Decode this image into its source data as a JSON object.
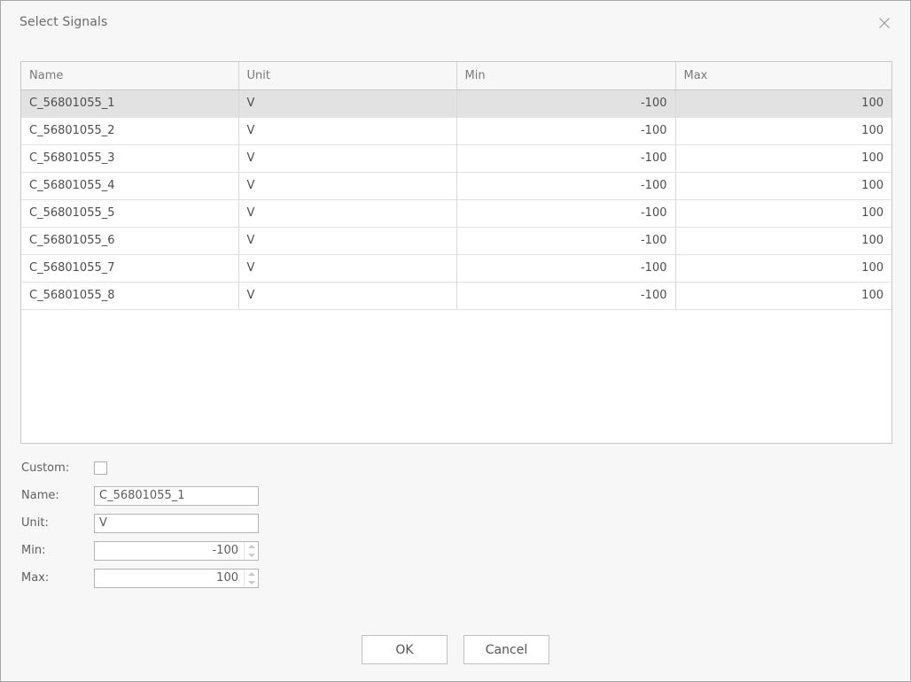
{
  "dialog": {
    "title": "Select Signals",
    "close_icon": "close-icon"
  },
  "table": {
    "columns": [
      "Name",
      "Unit",
      "Min",
      "Max"
    ],
    "rows": [
      {
        "name": "C_56801055_1",
        "unit": "V",
        "min": "-100",
        "max": "100",
        "selected": true
      },
      {
        "name": "C_56801055_2",
        "unit": "V",
        "min": "-100",
        "max": "100",
        "selected": false
      },
      {
        "name": "C_56801055_3",
        "unit": "V",
        "min": "-100",
        "max": "100",
        "selected": false
      },
      {
        "name": "C_56801055_4",
        "unit": "V",
        "min": "-100",
        "max": "100",
        "selected": false
      },
      {
        "name": "C_56801055_5",
        "unit": "V",
        "min": "-100",
        "max": "100",
        "selected": false
      },
      {
        "name": "C_56801055_6",
        "unit": "V",
        "min": "-100",
        "max": "100",
        "selected": false
      },
      {
        "name": "C_56801055_7",
        "unit": "V",
        "min": "-100",
        "max": "100",
        "selected": false
      },
      {
        "name": "C_56801055_8",
        "unit": "V",
        "min": "-100",
        "max": "100",
        "selected": false
      }
    ]
  },
  "form": {
    "custom": {
      "label": "Custom:",
      "checked": false
    },
    "name": {
      "label": "Name:",
      "value": "C_56801055_1"
    },
    "unit": {
      "label": "Unit:",
      "value": "V"
    },
    "min": {
      "label": "Min:",
      "value": "-100"
    },
    "max": {
      "label": "Max:",
      "value": "100"
    }
  },
  "buttons": {
    "ok": "OK",
    "cancel": "Cancel"
  },
  "colors": {
    "dialog_background": "#f7f7f7",
    "selected_row": "#e2e2e2",
    "border": "#c8c8c8",
    "text": "#5a5a5a"
  }
}
